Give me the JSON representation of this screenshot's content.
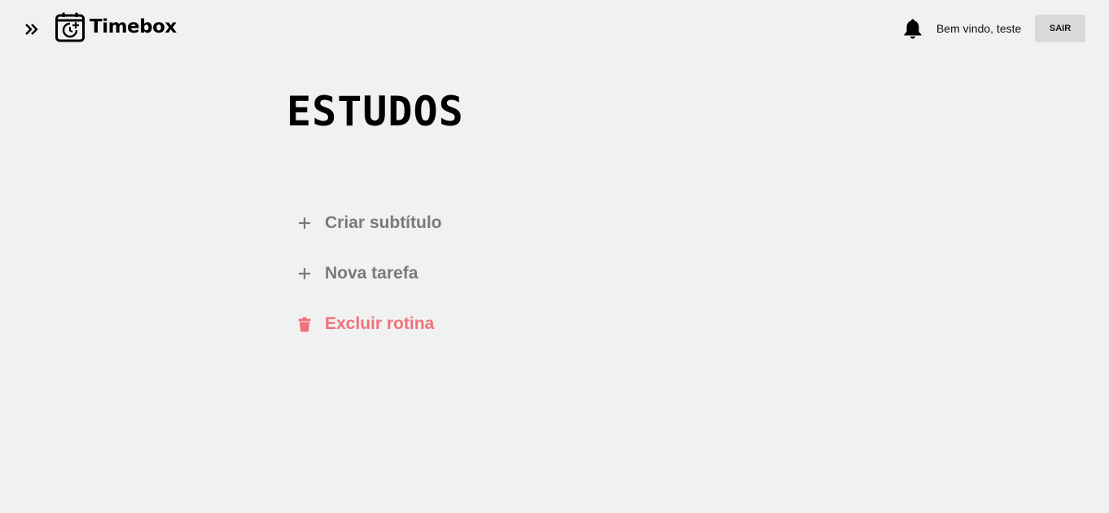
{
  "header": {
    "app_name": "Timebox",
    "welcome_text": "Bem vindo, teste",
    "logout_label": "SAIR",
    "icons": [
      "double-chevron-right-icon",
      "calendar-clock-icon",
      "bell-icon"
    ]
  },
  "main": {
    "title": "ESTUDOS",
    "actions": [
      {
        "label": "Criar subtítulo",
        "icon": "plus-icon"
      },
      {
        "label": "Nova tarefa",
        "icon": "plus-icon"
      },
      {
        "label": "Excluir rotina",
        "icon": "trash-icon"
      }
    ]
  },
  "colors": {
    "background": "#f1f1f1",
    "neutral_action": "#7a7a7a",
    "danger_action": "#f0717a",
    "logout_button_bg": "#d9d9d9"
  }
}
